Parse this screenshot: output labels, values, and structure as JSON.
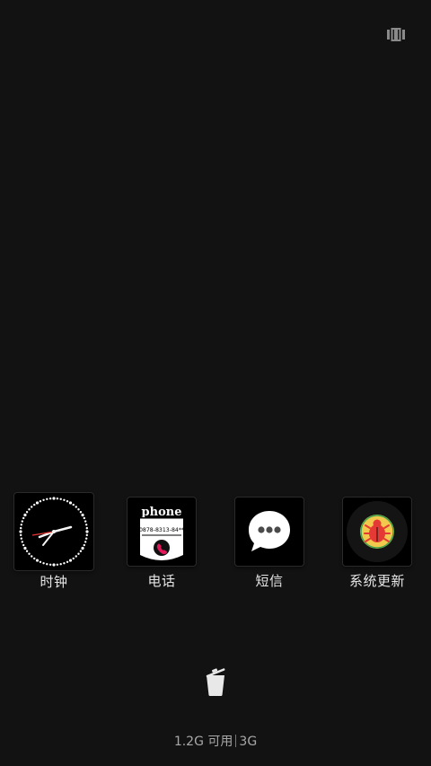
{
  "recents": {
    "apps": [
      {
        "label": "时钟",
        "icon": "clock-icon"
      },
      {
        "label": "电话",
        "icon": "phone-icon",
        "thumb_title": "phone",
        "thumb_number": "0878-8313-84**"
      },
      {
        "label": "短信",
        "icon": "message-icon"
      },
      {
        "label": "系统更新",
        "icon": "bug-icon"
      }
    ],
    "clear_button_icon": "trash-icon",
    "layout_toggle_icon": "grid-toggle-icon"
  },
  "memory": {
    "available": "1.2G 可用",
    "total": "3G"
  },
  "colors": {
    "background": "#121212",
    "clock_second_hand": "#e53935",
    "phone_accent": "#e2185b",
    "bug_ring": "#f2c94c",
    "bug_body": "#e53935",
    "bug_inner_ring": "#3fa34d"
  }
}
